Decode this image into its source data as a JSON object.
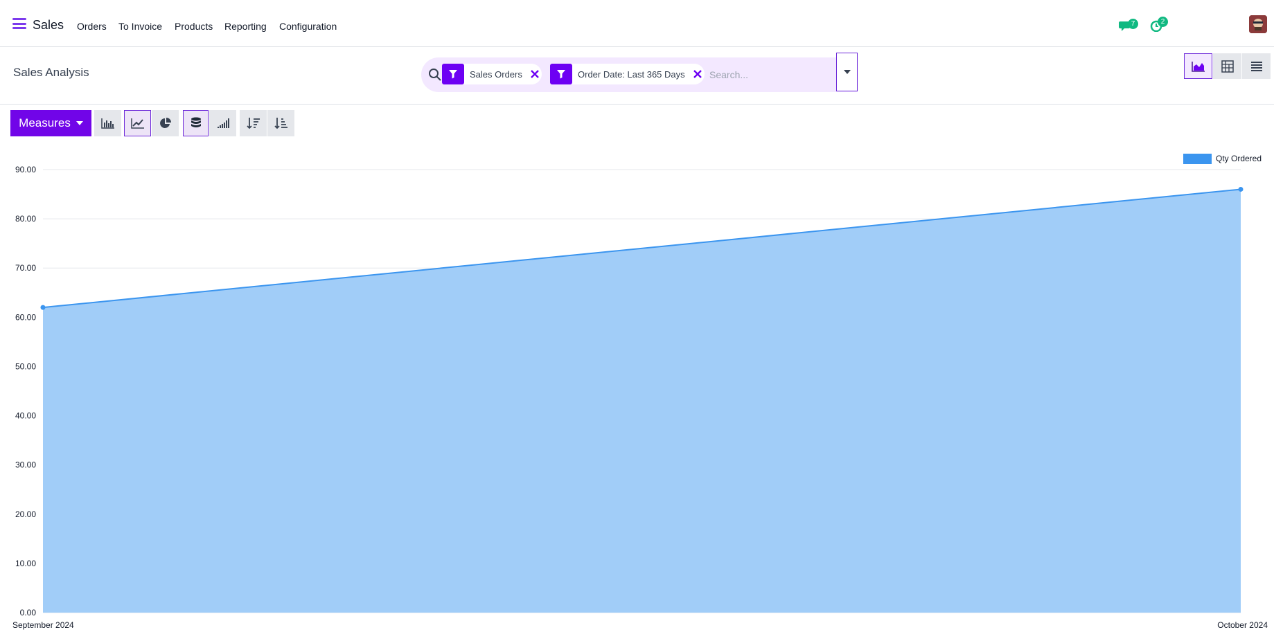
{
  "navbar": {
    "app_name": "Sales",
    "menu": [
      "Orders",
      "To Invoice",
      "Products",
      "Reporting",
      "Configuration"
    ],
    "messages_count": "7",
    "activities_count": "2",
    "icons": {
      "menu": "hamburger-icon",
      "messages": "chat-icon",
      "activities": "clock-icon",
      "avatar": "user-avatar"
    }
  },
  "control_panel": {
    "title": "Sales Analysis",
    "search": {
      "placeholder": "Search...",
      "facets": [
        {
          "label": "Sales Orders",
          "icon": "filter-icon"
        },
        {
          "label": "Order Date: Last 365 Days",
          "icon": "filter-icon"
        }
      ]
    },
    "views": [
      "graph",
      "pivot",
      "list"
    ],
    "active_view": "graph"
  },
  "toolbar": {
    "measures_label": "Measures",
    "buttons": [
      "bar-chart",
      "line-chart",
      "pie-chart",
      "stacked",
      "cumulative",
      "sort-descending",
      "sort-ascending"
    ],
    "active": [
      "line-chart",
      "stacked"
    ]
  },
  "colors": {
    "accent": "#7105e8",
    "series": "#3b95ef",
    "series_fill": "#a1cdf8",
    "badge": "#10b981"
  },
  "chart_data": {
    "type": "area",
    "categories": [
      "September 2024",
      "October 2024"
    ],
    "series": [
      {
        "name": "Qty Ordered",
        "values": [
          62,
          86
        ]
      }
    ],
    "ylim": [
      0,
      90
    ],
    "yticks": [
      "0.00",
      "10.00",
      "20.00",
      "30.00",
      "40.00",
      "50.00",
      "60.00",
      "70.00",
      "80.00",
      "90.00"
    ],
    "legend": "top-right",
    "grid": true
  }
}
